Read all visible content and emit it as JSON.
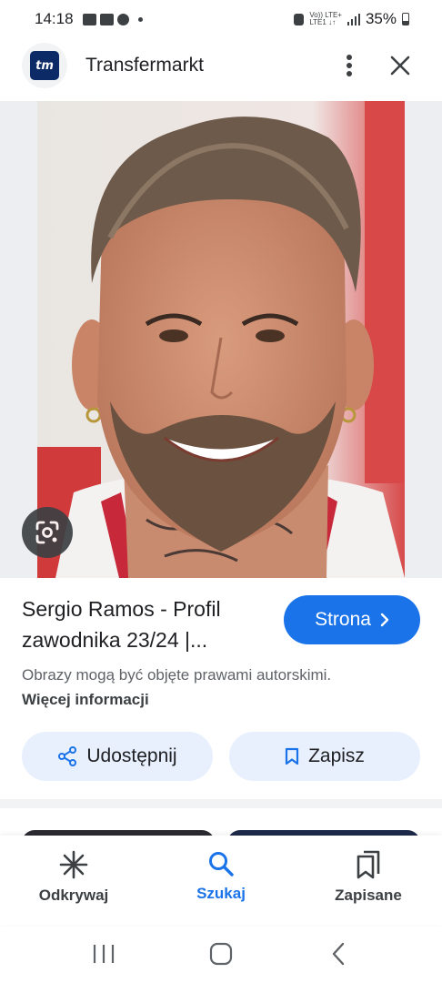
{
  "status_bar": {
    "time": "14:18",
    "network_line1": "Vo)) LTE+",
    "network_line2": "LTE1 ↓↑",
    "battery": "35%"
  },
  "header": {
    "logo_text": "tm",
    "title": "Transfermarkt"
  },
  "result": {
    "title": "Sergio Ramos - Profil zawodnika 23/24 |...",
    "visit_label": "Strona",
    "copyright_text": "Obrazy mogą być objęte prawami autorskimi.",
    "more_info_link": "Więcej informacji"
  },
  "actions": {
    "share_label": "Udostępnij",
    "save_label": "Zapisz"
  },
  "bottom_nav": {
    "items": [
      {
        "label": "Odkrywaj",
        "icon": "asterisk-icon"
      },
      {
        "label": "Szukaj",
        "icon": "search-icon"
      },
      {
        "label": "Zapisane",
        "icon": "bookmarks-icon"
      }
    ],
    "active_index": 1
  },
  "colors": {
    "accent": "#1a73e8",
    "chip_bg": "#e8f0fe"
  }
}
